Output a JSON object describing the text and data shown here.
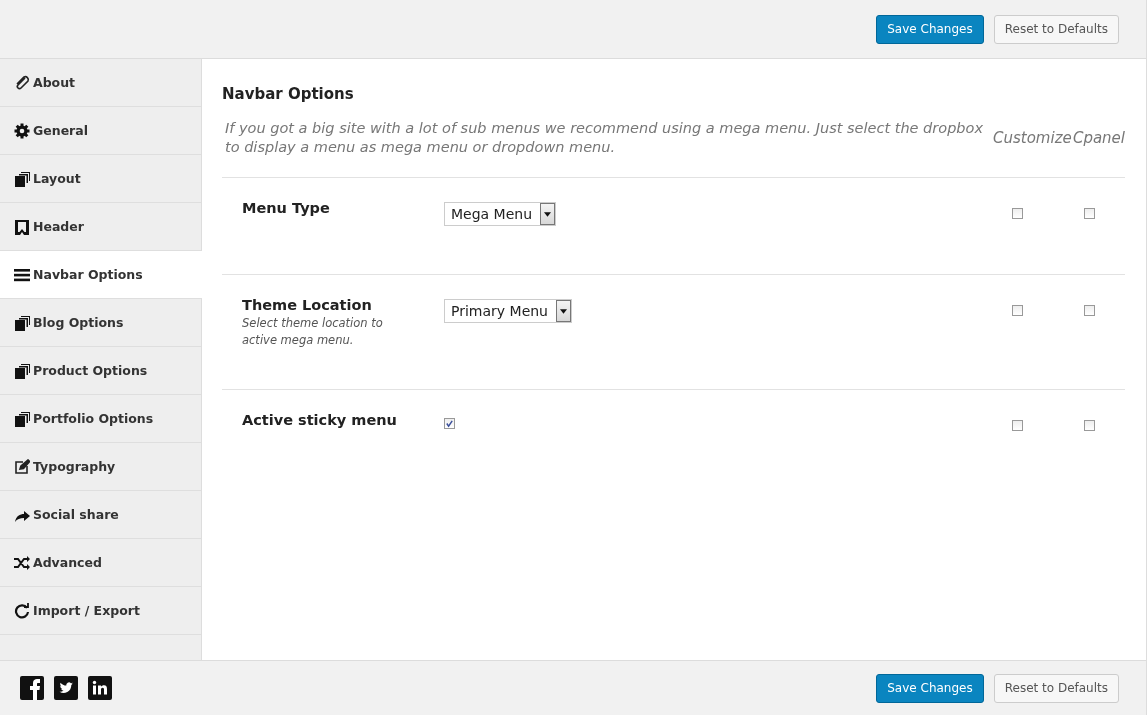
{
  "top_bar": {
    "buttons": [
      {
        "label": "Save Changes",
        "kind": "primary"
      },
      {
        "label": "Reset to Defaults",
        "kind": "secondary"
      }
    ]
  },
  "sidebar": {
    "items": [
      {
        "label": "About",
        "selected": false
      },
      {
        "label": "General",
        "selected": false
      },
      {
        "label": "Layout",
        "selected": false
      },
      {
        "label": "Header",
        "selected": false
      },
      {
        "label": "Navbar Options",
        "selected": true
      },
      {
        "label": "Blog Options",
        "selected": false
      },
      {
        "label": "Product Options",
        "selected": false
      },
      {
        "label": "Portfolio Options",
        "selected": false
      },
      {
        "label": "Typography",
        "selected": false
      },
      {
        "label": "Social share",
        "selected": false
      },
      {
        "label": "Advanced",
        "selected": false
      },
      {
        "label": "Import / Export",
        "selected": false
      }
    ]
  },
  "section": {
    "title": "Navbar Options",
    "description": "If you got a big site with a lot of sub menus we recommend using a mega menu. Just select the dropbox to display a menu as mega menu or dropdown menu.",
    "column_headers": [
      "Customize",
      "Cpanel"
    ],
    "rows": [
      {
        "label": "Menu Type",
        "kind": "select",
        "value": "Mega Menu",
        "customize": false,
        "cpanel": false
      },
      {
        "label": "Theme Location",
        "hint": "Select theme location to active mega menu.",
        "kind": "select",
        "value": "Primary Menu",
        "customize": false,
        "cpanel": false
      },
      {
        "label": "Active sticky menu",
        "kind": "checkbox",
        "checked": true,
        "customize": false,
        "cpanel": false
      }
    ]
  },
  "footer": {
    "buttons": [
      {
        "label": "Save Changes",
        "kind": "primary"
      },
      {
        "label": "Reset to Defaults",
        "kind": "secondary"
      }
    ]
  }
}
